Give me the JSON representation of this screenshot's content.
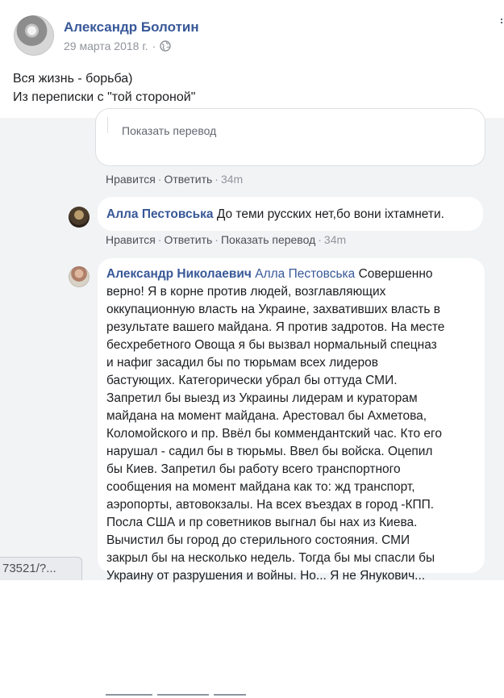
{
  "post": {
    "author": "Александр Болотин",
    "date": "29 марта 2018 г.",
    "dot": "·",
    "privacy_icon": "globe-icon",
    "text_lines": [
      "Вся жизнь - борьба)",
      "Из переписки с \"той стороной\""
    ]
  },
  "previous_comment": {
    "show_translation": "Показать перевод",
    "like": "Нравится",
    "reply": "Ответить",
    "time": "34m"
  },
  "comments": [
    {
      "author": "Алла Пестовська",
      "text": "До теми русских нет,бо вони іхтамнети.",
      "like": "Нравится",
      "reply": "Ответить",
      "translate": "Показать перевод",
      "time": "34m"
    },
    {
      "author": "Александр Николаевич",
      "mention": "Алла Пестовська",
      "first_line_rest": "Совершенно",
      "lines": [
        "верно! Я в корне против людей, возглавляющих",
        "оккупационную власть на Украине, захвативших власть в",
        "результате вашего майдана. Я против задротов. На месте",
        "бесхребетного Овоща я бы вызвал нормальный спецназ",
        "и нафиг засадил бы по тюрьмам всех лидеров",
        "бастующих. Категорически убрал бы оттуда СМИ.",
        "Запретил бы выезд из Украины лидерам и кураторам",
        "майдана на момент майдана. Арестовал бы Ахметова,",
        "Коломойского и пр. Ввёл бы коммендантский час. Кто его",
        "нарушал - садил бы в тюрьмы. Ввел бы войска. Оцепил",
        "бы Киев. Запретил бы работу всего транспортного",
        "сообщения на момент майдана как то: жд транспорт,",
        "аэропорты, автовокзалы. На всех въездах в город -КПП.",
        "Посла США и пр советников выгнал бы нах из Киева.",
        "Вычистил бы город до стерильного состояния. СМИ",
        "закрыл бы на несколько недель. Тогда бы мы спасли бы",
        "Украину от разрушения и войны. Но... Я не Янукович..."
      ]
    }
  ],
  "separator": "·",
  "url_fragment": "73521/?..."
}
